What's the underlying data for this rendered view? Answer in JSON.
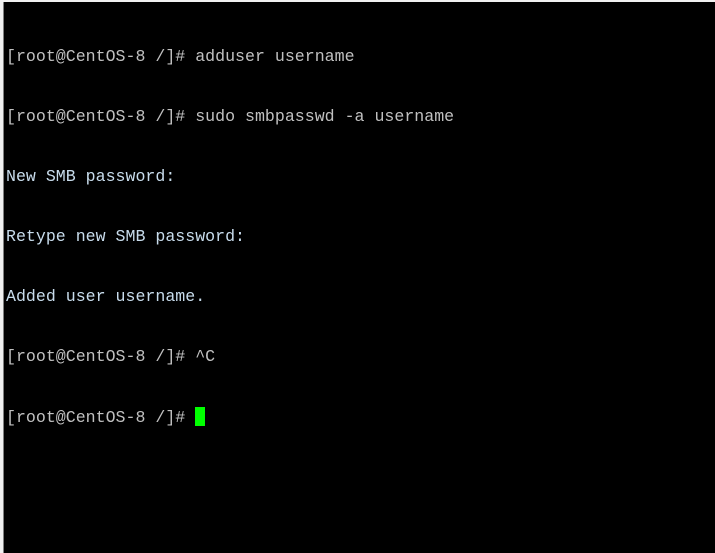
{
  "terminal": {
    "lines": [
      {
        "prompt": "[root@CentOS-8 /]# ",
        "text": "adduser username"
      },
      {
        "prompt": "[root@CentOS-8 /]# ",
        "text": "sudo smbpasswd -a username"
      },
      {
        "prompt": "",
        "text": "New SMB password:"
      },
      {
        "prompt": "",
        "text": "Retype new SMB password:"
      },
      {
        "prompt": "",
        "text": "Added user username."
      },
      {
        "prompt": "[root@CentOS-8 /]# ",
        "text": "^C"
      }
    ],
    "current_prompt": "[root@CentOS-8 /]# ",
    "cursor_color": "#00ff00",
    "background_color": "#000000"
  }
}
